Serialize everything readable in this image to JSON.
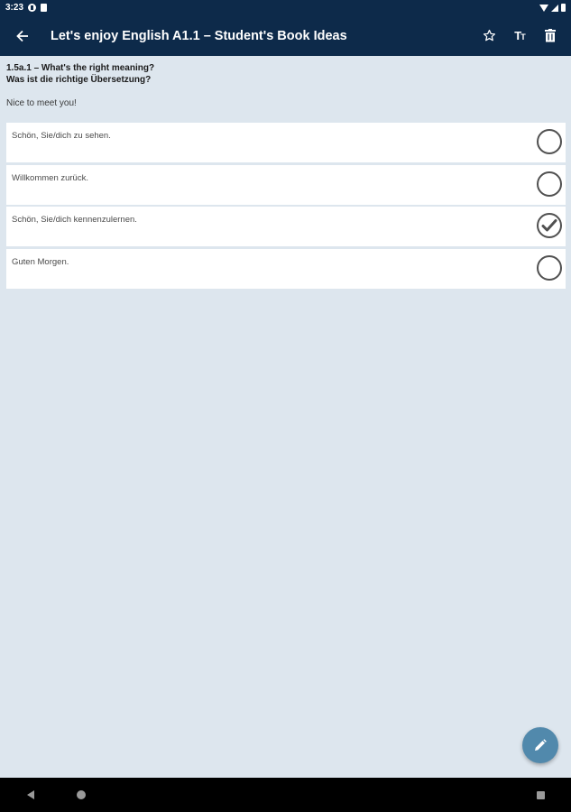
{
  "status_bar": {
    "time": "3:23",
    "icons": [
      "app-notification-icon",
      "sd-card-icon",
      "wifi-icon",
      "signal-icon",
      "battery-icon"
    ]
  },
  "app_bar": {
    "title": "Let's enjoy English A1.1 – Student's Book Ideas",
    "actions": [
      "star-icon",
      "text-size-icon",
      "delete-icon"
    ],
    "text_size_label": "T",
    "text_size_small": "T"
  },
  "question": {
    "header_line1": "1.5a.1 – What's the right meaning?",
    "header_line2": "Was ist die richtige Übersetzung?",
    "prompt": "Nice to meet you!"
  },
  "options": [
    {
      "label": "Schön, Sie/dich zu sehen.",
      "selected": false
    },
    {
      "label": "Willkommen zurück.",
      "selected": false
    },
    {
      "label": "Schön, Sie/dich kennenzulernen.",
      "selected": true
    },
    {
      "label": "Guten Morgen.",
      "selected": false
    }
  ],
  "fab": {
    "icon": "pencil-icon"
  },
  "colors": {
    "app_bar": "#0d2a4a",
    "background": "#dde6ee",
    "fab": "#5189ac"
  }
}
